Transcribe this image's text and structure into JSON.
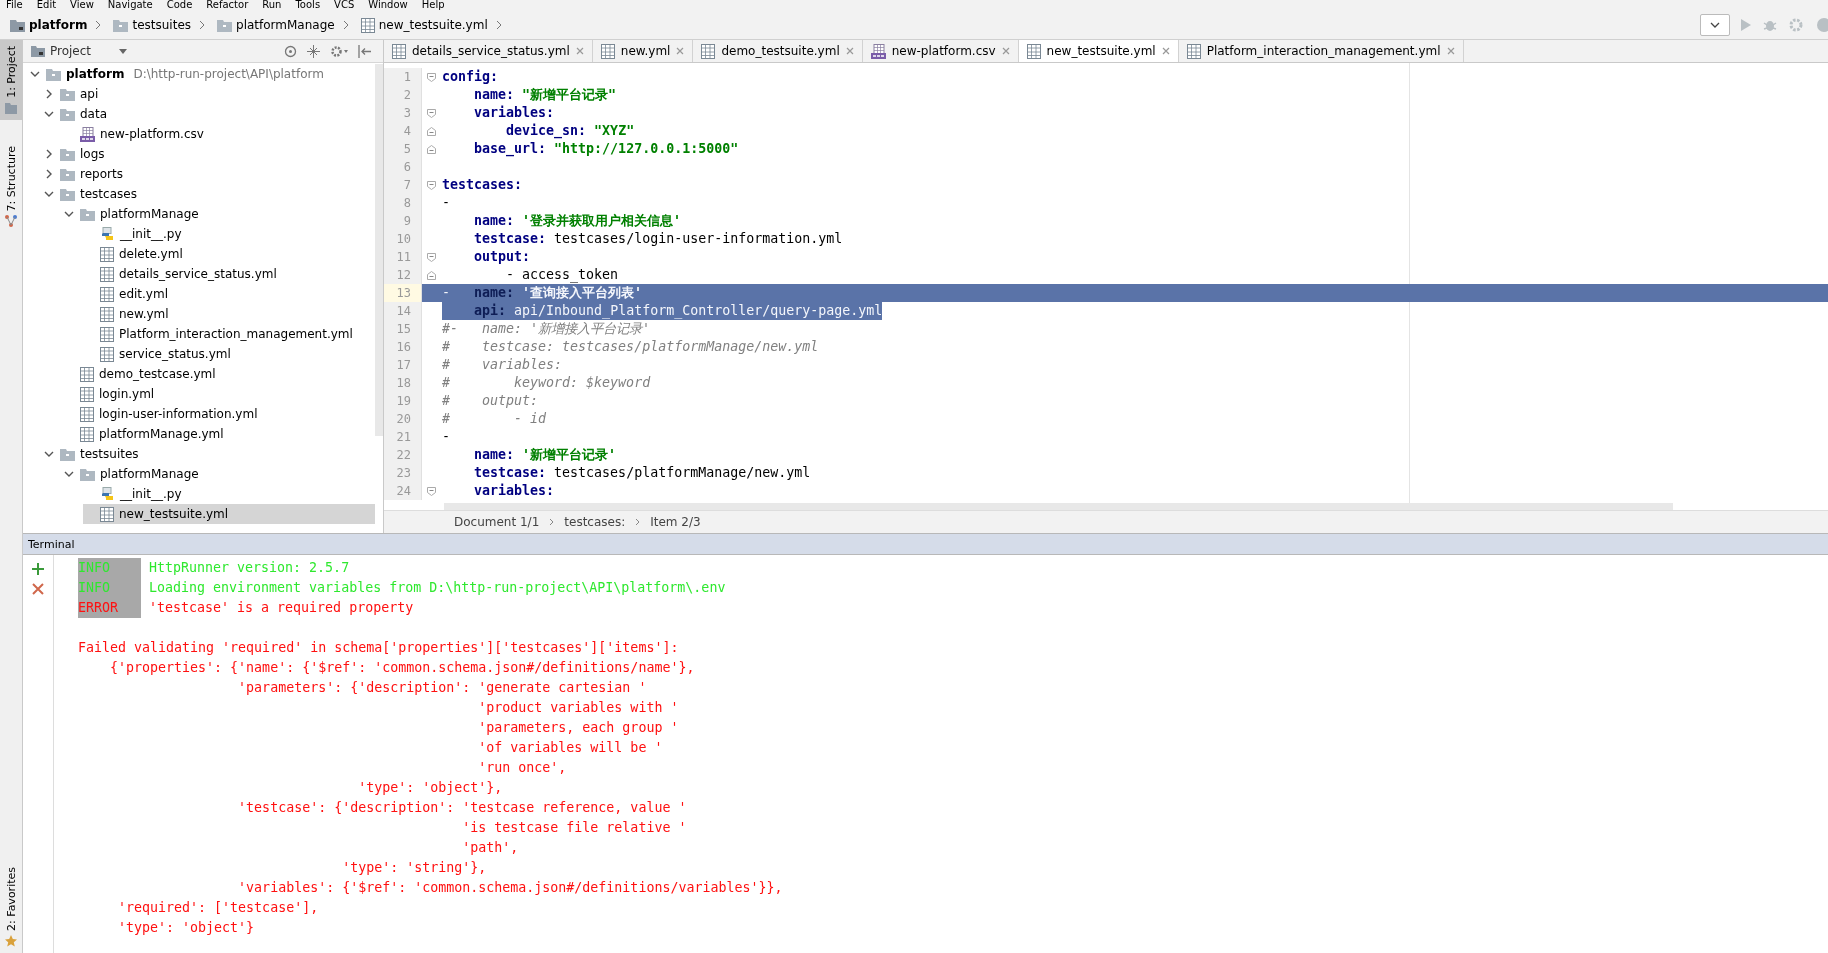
{
  "menu_bar": [
    "File",
    "Edit",
    "View",
    "Navigate",
    "Code",
    "Refactor",
    "Run",
    "Tools",
    "VCS",
    "Window",
    "Help"
  ],
  "nav_bar": {
    "crumbs": [
      {
        "label": "platform",
        "kind": "project"
      },
      {
        "label": "testsuites",
        "kind": "folder"
      },
      {
        "label": "platformManage",
        "kind": "folder"
      },
      {
        "label": "new_testsuite.yml",
        "kind": "yaml"
      }
    ]
  },
  "tool_strip": {
    "top": [
      {
        "label": "1: Project",
        "kind": "project",
        "selected": true
      },
      {
        "label": "7: Structure",
        "kind": "structure",
        "selected": false
      }
    ],
    "bottom": [
      {
        "label": "2: Favorites",
        "kind": "favorites",
        "selected": false
      }
    ]
  },
  "project_panel": {
    "title": "Project",
    "tree": [
      {
        "label": "platform",
        "path": "D:\\http-run-project\\API\\platform",
        "kind": "root",
        "expanded": true,
        "selected": false,
        "children": [
          {
            "label": "api",
            "kind": "folder",
            "expanded": false,
            "selected": false
          },
          {
            "label": "data",
            "kind": "folder",
            "expanded": true,
            "selected": false,
            "children": [
              {
                "label": "new-platform.csv",
                "kind": "csv",
                "selected": false
              }
            ]
          },
          {
            "label": "logs",
            "kind": "folder",
            "expanded": false,
            "selected": false
          },
          {
            "label": "reports",
            "kind": "folder",
            "expanded": false,
            "selected": false
          },
          {
            "label": "testcases",
            "kind": "folder",
            "expanded": true,
            "selected": false,
            "children": [
              {
                "label": "platformManage",
                "kind": "folder",
                "expanded": true,
                "selected": false,
                "children": [
                  {
                    "label": "__init__.py",
                    "kind": "python",
                    "selected": false
                  },
                  {
                    "label": "delete.yml",
                    "kind": "yaml",
                    "selected": false
                  },
                  {
                    "label": "details_service_status.yml",
                    "kind": "yaml",
                    "selected": false
                  },
                  {
                    "label": "edit.yml",
                    "kind": "yaml",
                    "selected": false
                  },
                  {
                    "label": "new.yml",
                    "kind": "yaml",
                    "selected": false
                  },
                  {
                    "label": "Platform_interaction_management.yml",
                    "kind": "yaml",
                    "selected": false
                  },
                  {
                    "label": "service_status.yml",
                    "kind": "yaml",
                    "selected": false
                  }
                ]
              },
              {
                "label": "demo_testcase.yml",
                "kind": "yaml",
                "selected": false
              },
              {
                "label": "login.yml",
                "kind": "yaml",
                "selected": false
              },
              {
                "label": "login-user-information.yml",
                "kind": "yaml",
                "selected": false
              },
              {
                "label": "platformManage.yml",
                "kind": "yaml",
                "selected": false
              }
            ]
          },
          {
            "label": "testsuites",
            "kind": "folder",
            "expanded": true,
            "selected": false,
            "children": [
              {
                "label": "platformManage",
                "kind": "folder",
                "expanded": true,
                "selected": false,
                "children": [
                  {
                    "label": "__init__.py",
                    "kind": "python",
                    "selected": false
                  },
                  {
                    "label": "new_testsuite.yml",
                    "kind": "yaml",
                    "selected": true
                  }
                ]
              }
            ]
          }
        ]
      }
    ]
  },
  "editor": {
    "tabs": [
      {
        "label": "details_service_status.yml",
        "kind": "yaml",
        "selected": false
      },
      {
        "label": "new.yml",
        "kind": "yaml",
        "selected": false
      },
      {
        "label": "demo_testsuite.yml",
        "kind": "yaml",
        "selected": false
      },
      {
        "label": "new-platform.csv",
        "kind": "csv",
        "selected": false
      },
      {
        "label": "new_testsuite.yml",
        "kind": "yaml",
        "selected": true
      },
      {
        "label": "Platform_interaction_management.yml",
        "kind": "yaml",
        "selected": false
      }
    ],
    "lines": [
      {
        "number": "1",
        "kind": "fold_start",
        "selected": false,
        "caret": false,
        "segments": [
          {
            "kind": "key",
            "text": "config:"
          }
        ]
      },
      {
        "number": "2",
        "selected": false,
        "caret": false,
        "segments": [
          {
            "kind": "key",
            "text": "    name: "
          },
          {
            "kind": "str",
            "text": "\"新增平台记录\""
          }
        ]
      },
      {
        "number": "3",
        "kind": "fold_start",
        "selected": false,
        "caret": false,
        "segments": [
          {
            "kind": "key",
            "text": "    variables:"
          }
        ]
      },
      {
        "number": "4",
        "kind": "fold_end",
        "selected": false,
        "caret": false,
        "segments": [
          {
            "kind": "key",
            "text": "        device_sn: "
          },
          {
            "kind": "str",
            "text": "\"XYZ\""
          }
        ]
      },
      {
        "number": "5",
        "kind": "fold_end",
        "selected": false,
        "caret": false,
        "segments": [
          {
            "kind": "key",
            "text": "    base_url: "
          },
          {
            "kind": "str",
            "text": "\"http://127.0.0.1:5000\""
          }
        ]
      },
      {
        "number": "6",
        "selected": false,
        "caret": false
      },
      {
        "number": "7",
        "kind": "fold_start",
        "selected": false,
        "caret": false,
        "segments": [
          {
            "kind": "key",
            "text": "testcases:"
          }
        ]
      },
      {
        "number": "8",
        "selected": false,
        "caret": false,
        "segments": [
          {
            "kind": "plain",
            "text": "-"
          }
        ]
      },
      {
        "number": "9",
        "selected": false,
        "caret": false,
        "segments": [
          {
            "kind": "key",
            "text": "    name: "
          },
          {
            "kind": "str",
            "text": "'登录并获取用户相关信息'"
          }
        ]
      },
      {
        "number": "10",
        "selected": false,
        "caret": false,
        "segments": [
          {
            "kind": "key",
            "text": "    testcase: "
          },
          {
            "kind": "plain",
            "text": "testcases/login-user-information.yml"
          }
        ]
      },
      {
        "number": "11",
        "kind": "fold_start",
        "selected": false,
        "caret": false,
        "segments": [
          {
            "kind": "key",
            "text": "    output:"
          }
        ]
      },
      {
        "number": "12",
        "kind": "fold_end",
        "selected": false,
        "caret": false,
        "segments": [
          {
            "kind": "plain",
            "text": "        - access_token"
          }
        ]
      },
      {
        "number": "13",
        "selected": true,
        "caret": true,
        "segments": [
          {
            "kind": "plain",
            "text": "-   "
          },
          {
            "kind": "key",
            "text": "name: "
          },
          {
            "kind": "str",
            "text": "'查询接入平台列表'"
          }
        ]
      },
      {
        "number": "14",
        "selected": true,
        "caret": false,
        "segments": [
          {
            "kind": "key",
            "text": "    api: "
          },
          {
            "kind": "plain",
            "text": "api/Inbound_Platform_Controller/query-page.yml"
          }
        ]
      },
      {
        "number": "15",
        "selected": false,
        "caret": false,
        "segments": [
          {
            "kind": "comment",
            "text": "#-   name: '新增接入平台记录'"
          }
        ]
      },
      {
        "number": "16",
        "selected": false,
        "caret": false,
        "segments": [
          {
            "kind": "comment",
            "text": "#    testcase: testcases/platformManage/new.yml"
          }
        ]
      },
      {
        "number": "17",
        "selected": false,
        "caret": false,
        "segments": [
          {
            "kind": "comment",
            "text": "#    variables:"
          }
        ]
      },
      {
        "number": "18",
        "selected": false,
        "caret": false,
        "segments": [
          {
            "kind": "comment",
            "text": "#        keyword: $keyword"
          }
        ]
      },
      {
        "number": "19",
        "selected": false,
        "caret": false,
        "segments": [
          {
            "kind": "comment",
            "text": "#    output:"
          }
        ]
      },
      {
        "number": "20",
        "selected": false,
        "caret": false,
        "segments": [
          {
            "kind": "comment",
            "text": "#        - id"
          }
        ]
      },
      {
        "number": "21",
        "selected": false,
        "caret": false,
        "segments": [
          {
            "kind": "plain",
            "text": "-"
          }
        ]
      },
      {
        "number": "22",
        "selected": false,
        "caret": false,
        "segments": [
          {
            "kind": "key",
            "text": "    name: "
          },
          {
            "kind": "str",
            "text": "'新增平台记录'"
          }
        ]
      },
      {
        "number": "23",
        "selected": false,
        "caret": false,
        "segments": [
          {
            "kind": "key",
            "text": "    testcase: "
          },
          {
            "kind": "plain",
            "text": "testcases/platformManage/new.yml"
          }
        ]
      },
      {
        "number": "24",
        "kind": "fold_start",
        "selected": false,
        "caret": false,
        "segments": [
          {
            "kind": "key",
            "text": "    variables:"
          }
        ]
      }
    ],
    "breadcrumbs": [
      "Document 1/1",
      "testcases:",
      "Item 2/3"
    ]
  },
  "terminal": {
    "title": "Terminal",
    "log": [
      {
        "level": "INFO",
        "kind": "info",
        "message": "HttpRunner version: 2.5.7"
      },
      {
        "level": "INFO",
        "kind": "info",
        "message": "Loading environment variables from D:\\http-run-project\\API\\platform\\.env"
      },
      {
        "level": "ERROR",
        "kind": "error",
        "message": "'testcase' is a required property"
      }
    ],
    "traceback": [
      "Failed validating 'required' in schema['properties']['testcases']['items']:",
      "    {'properties': {'name': {'$ref': 'common.schema.json#/definitions/name'},",
      "                    'parameters': {'description': 'generate cartesian '",
      "                                                  'product variables with '",
      "                                                  'parameters, each group '",
      "                                                  'of variables will be '",
      "                                                  'run once',",
      "                                   'type': 'object'},",
      "                    'testcase': {'description': 'testcase reference, value '",
      "                                                'is testcase file relative '",
      "                                                'path',",
      "                                 'type': 'string'},",
      "                    'variables': {'$ref': 'common.schema.json#/definitions/variables'}},",
      "     'required': ['testcase'],",
      "     'type': 'object'}"
    ]
  }
}
